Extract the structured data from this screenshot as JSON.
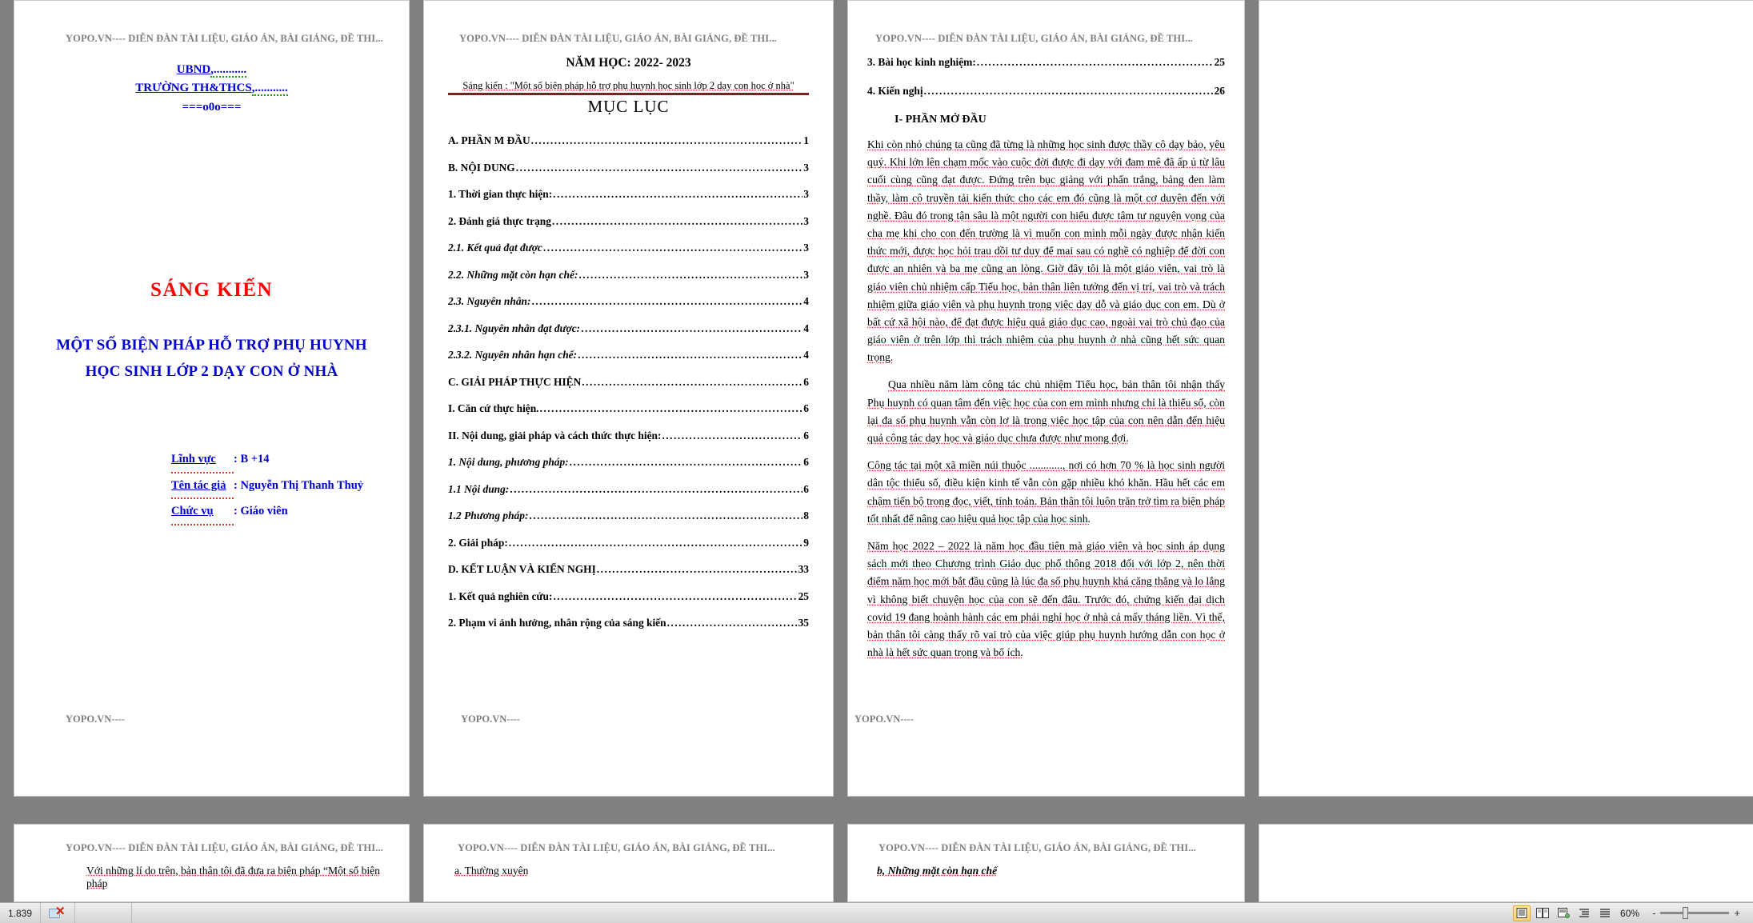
{
  "app": {
    "zoom_level": "60%",
    "word_count": "1.839"
  },
  "watermark": {
    "header": "YOPO.VN---- DIỄN ĐÀN TÀI LIỆU, GIÁO ÁN, BÀI GIẢNG, ĐỀ THI...",
    "footer": "YOPO.VN----"
  },
  "page1": {
    "org_line1": "UBND",
    "org_line1_dots": ",...........",
    "org_line2": "TRƯỜNG TH&THCS",
    "org_line2_dots": ",...........",
    "org_line3": "===o0o===",
    "sang_kien": "SÁNG  KIẾN",
    "title_line1": "MỘT SỐ BIỆN PHÁP HỖ TRỢ PHỤ HUYNH",
    "title_line2": "HỌC SINH LỚP 2 DẠY CON Ở NHÀ",
    "meta": [
      {
        "label": "Lĩnh vực",
        "value": ": B +14"
      },
      {
        "label": "Tên tác giả",
        "value": ": Nguyễn Thị Thanh Thuỷ"
      },
      {
        "label": "Chức vụ",
        "value": ": Giáo viên"
      }
    ]
  },
  "page2": {
    "school_year": "NĂM HỌC: 2022- 2023",
    "sang_kien_line": "Sáng kiến : \"Một số  biện pháp hỗ trợ phụ huynh học sinh lớp 2 dạy con học ở nhà\"",
    "muc_luc_title": "MỤC LỤC",
    "toc": [
      {
        "label": "A. PHẦN M ĐẦU ",
        "page": "1",
        "style": "bold"
      },
      {
        "label": "B. NỘI DUNG",
        "page": "3",
        "style": "bold"
      },
      {
        "label": "1. Thời gian thực hiện:",
        "page": "3",
        "style": "bold"
      },
      {
        "label": "2.  Đánh giá thực trạng",
        "page": "3",
        "style": "bold"
      },
      {
        "label": "2.1. Kết quả đạt được ",
        "page": "3",
        "style": "bolditalic"
      },
      {
        "label": "2.2.  Những mặt còn hạn chế:",
        "page": "3",
        "style": "bolditalic"
      },
      {
        "label": "2.3.  Nguyên nhân:",
        "page": "4",
        "style": "bolditalic"
      },
      {
        "label": "2.3.1. Nguyên nhân đạt được:",
        "page": "4",
        "style": "bolditalic"
      },
      {
        "label": "2.3.2. Nguyên nhân hạn chế:",
        "page": "4",
        "style": "bolditalic"
      },
      {
        "label": "C. GIẢI PHÁP THỰC HIỆN",
        "page": "6",
        "style": "bold"
      },
      {
        "label": "I. Căn cứ thực hiện.",
        "page": "6",
        "style": "bold"
      },
      {
        "label": "II. Nội dung, giải pháp và cách thức thực hiện:",
        "page": "6",
        "style": "bold"
      },
      {
        "label": "1. Nội dung, phương pháp:",
        "page": "6",
        "style": "bolditalic"
      },
      {
        "label": "1.1 Nội dung: ",
        "page": "6",
        "style": "bolditalic"
      },
      {
        "label": "1.2 Phương pháp:",
        "page": "8",
        "style": "bolditalic"
      },
      {
        "label": "2. Giải pháp: ",
        "page": "9",
        "style": "bold"
      },
      {
        "label": "D. KẾT LUẬN VÀ KIẾN NGHỊ ",
        "page": "33",
        "style": "bold"
      },
      {
        "label": "1.   Kết quả nghiên cứu:",
        "page": "25",
        "style": "bold"
      },
      {
        "label": "2.   Phạm vi ảnh hưởng, nhân rộng của sáng kiến",
        "page": "35",
        "style": "bold"
      }
    ]
  },
  "page3": {
    "toc": [
      {
        "label": "3.   Bài học kinh nghiệm:",
        "page": "25",
        "style": "bold"
      },
      {
        "label": "4.   Kiến nghị ",
        "page": "26",
        "style": "bold"
      }
    ],
    "section_heading": "I- PHẦN MỞ ĐẦU",
    "paragraphs": [
      "Khi còn nhỏ chúng ta cũng đã từng là những học sinh được thầy cô dạy bảo, yêu quý. Khi lớn lên chạm mốc vào cuộc đời được đi dạy với đam mê đã ấp ủ từ lâu cuối cùng cũng đạt được. Đứng trên bục giảng với phấn trắng, bảng đen làm thầy, làm cô truyền tải kiến thức cho các em đó cũng là một cơ duyên đến với nghề. Đâu đó trong tận sâu là một người con hiểu được tâm tư nguyện vọng của cha mẹ khi cho con đến trường là vì muốn con mình mỗi ngày được nhận kiến thức mới, được học hỏi trau dồi tư duy để mai sau có nghề có nghiệp để đời con được an nhiên và ba mẹ cũng an lòng. Giờ đây tôi là một giáo viên, vai trò là giáo viên chủ nhiệm cấp Tiểu học, bản thân liên tưởng đến vị trí, vai trò và trách nhiệm giữa giáo viên và phụ huynh trong việc dạy dỗ và giáo dục con em. Dù ở bất cứ xã hội nào, để đạt được hiệu quả giáo dục cao, ngoài vai trò chủ đạo của giáo viên ở trên lớp thì trách nhiệm của phụ huynh ở nhà cũng hết sức quan trọng.",
      "Qua nhiều năm làm công tác chủ nhiệm Tiểu học, bản thân tôi nhận thấy Phụ huynh có quan tâm đến việc học của con em mình nhưng chỉ là thiểu số, còn lại đa số phụ huynh vẫn còn lơ là trong việc học tập của con nên dẫn đến hiệu quả công tác dạy học và giáo dục chưa được như mong đợi.",
      "Công tác tại một xã miền núi thuộc ............, nơi có hơn 70 % là học sinh người dân tộc thiểu số, điều kiện kinh tế vẫn còn gặp nhiều khó khăn. Hầu hết các em chậm tiến bộ trong đọc, viết, tính toán. Bản thân tôi luôn trăn trở tìm ra biện pháp tốt nhất để nâng cao hiệu quả học tập của học sinh.",
      "Năm học 2022 – 2022 là năm học đầu tiên mà giáo viên và học sinh áp dụng sách mới theo Chương trình Giáo dục phổ thông 2018 đối với lớp 2, nên thời điểm năm học mới bắt đầu cũng là lúc đa số phụ huynh khá căng thẳng và lo lắng vì không biết chuyện học của con sẽ đến đâu. Trước đó, chứng kiến đại dịch covid 19 đang hoành hành các em phải nghỉ học ở nhà cả mấy tháng liền. Vì thế, bản thân tôi càng thấy rõ vai trò của việc giúp phụ huynh hướng dẫn con học ở nhà là hết sức quan trọng và bổ ích."
    ]
  },
  "row2": {
    "page4_fragment": "Với những lí do trên, bản thân tôi đã đưa ra biện pháp “Một số biện pháp",
    "page4_fragment_bold": "Một số biện pháp",
    "page5_fragment": "a.  Thường xuyên",
    "page6_fragment": "b, Những mặt còn hạn chế"
  },
  "statusbar": {
    "word_count_label": "1.839",
    "spell_check_icon": "spell-check-icon",
    "views": [
      {
        "name": "print-layout-view",
        "glyph": "▤",
        "active": true
      },
      {
        "name": "full-screen-reading-view",
        "glyph": "▣",
        "active": false
      },
      {
        "name": "web-layout-view",
        "glyph": "▤",
        "active": false
      },
      {
        "name": "outline-view",
        "glyph": "☰",
        "active": false
      },
      {
        "name": "draft-view",
        "glyph": "☰",
        "active": false
      }
    ],
    "zoom_label": "60%",
    "zoom_out": "-",
    "zoom_in": "+"
  }
}
